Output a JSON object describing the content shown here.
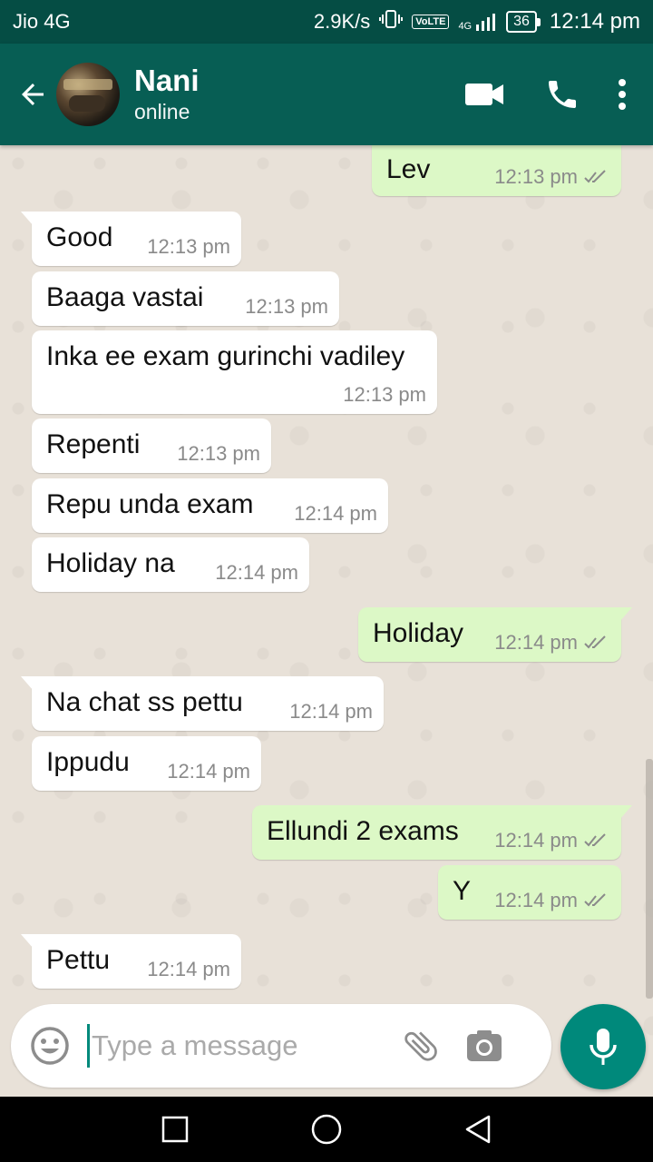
{
  "status_bar": {
    "carrier": "Jio 4G",
    "speed": "2.9K/s",
    "volte": "VoLTE",
    "network": "4G",
    "battery": "36",
    "time": "12:14 pm"
  },
  "header": {
    "contact_name": "Nani",
    "contact_status": "online",
    "icons": [
      "back-arrow-icon",
      "video-call-icon",
      "phone-icon",
      "more-vert-icon"
    ]
  },
  "messages": [
    {
      "direction": "out",
      "text": "Lev",
      "time": "12:13 pm",
      "read": true
    },
    {
      "direction": "in",
      "text": "Good",
      "time": "12:13 pm"
    },
    {
      "direction": "in",
      "text": "Baaga vastai",
      "time": "12:13 pm"
    },
    {
      "direction": "in",
      "text": "Inka ee exam gurinchi vadiley",
      "time": "12:13 pm"
    },
    {
      "direction": "in",
      "text": "Repenti",
      "time": "12:13 pm"
    },
    {
      "direction": "in",
      "text": "Repu unda exam",
      "time": "12:14 pm"
    },
    {
      "direction": "in",
      "text": "Holiday na",
      "time": "12:14 pm"
    },
    {
      "direction": "out",
      "text": "Holiday",
      "time": "12:14 pm",
      "read": true
    },
    {
      "direction": "in",
      "text": "Na chat ss pettu",
      "time": "12:14 pm"
    },
    {
      "direction": "in",
      "text": "Ippudu",
      "time": "12:14 pm"
    },
    {
      "direction": "out",
      "text": "Ellundi 2 exams",
      "time": "12:14 pm",
      "read": true
    },
    {
      "direction": "out",
      "text": "Y",
      "time": "12:14 pm",
      "read": true
    },
    {
      "direction": "in",
      "text": "Pettu",
      "time": "12:14 pm"
    }
  ],
  "input": {
    "placeholder": "Type a message",
    "value": ""
  },
  "colors": {
    "header": "#075e54",
    "status_bar": "#054d44",
    "outgoing_bubble": "#dcf8c6",
    "incoming_bubble": "#ffffff",
    "accent": "#00897b",
    "read_ticks": "#8a8a8a"
  }
}
